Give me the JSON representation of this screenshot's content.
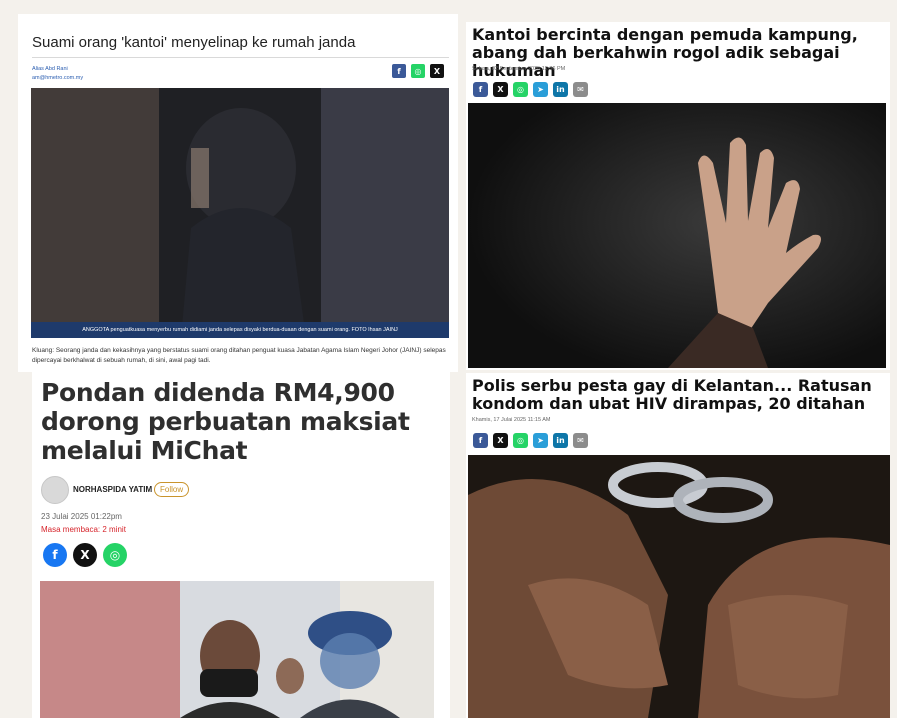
{
  "article1": {
    "title": "Suami orang 'kantoi' menyelinap ke rumah janda",
    "author": "Alias Abd Rani",
    "email": "am@hmetro.com.my",
    "share": [
      "f",
      "◎",
      "X"
    ],
    "photo_caption": "ANGGOTA penguatkuasa menyerbu rumah didiami janda selepas disyaki berdua-duaan dengan suami orang. FOTO Ihsan JAINJ",
    "lede": "Kluang: Seorang janda dan kekasihnya yang berstatus suami orang ditahan penguat kuasa Jabatan Agama Islam Negeri Johor (JAINJ) selepas dipercayai berkhalwat di sebuah rumah, di sini, awal pagi tadi."
  },
  "article2": {
    "title": "Kantoi bercinta dengan pemuda kampung, abang dah berkahwin rogol adik sebagai hukuman",
    "date": "Selasa, 02 September 2025 12:36 PM",
    "share": [
      "f",
      "X",
      "◎",
      "➤",
      "in",
      "✉"
    ]
  },
  "article3": {
    "title": "Pondan didenda RM4,900 dorong perbuatan maksiat melalui MiChat",
    "author": "NORHASPIDA YATIM",
    "follow": "Follow",
    "date": "23 Julai 2025 01:22pm",
    "reading_time": "Masa membaca: 2 minit",
    "share": [
      "f",
      "X",
      "◎"
    ]
  },
  "article4": {
    "title": "Polis serbu pesta gay di Kelantan... Ratusan kondom dan ubat HIV dirampas, 20 ditahan",
    "date": "Khamis, 17 Julai 2025 11:15 AM",
    "share": [
      "f",
      "X",
      "◎",
      "➤",
      "in",
      "✉"
    ]
  },
  "colors": {
    "facebook": "#3b5998",
    "whatsapp": "#25d366",
    "x": "#111111",
    "telegram": "#2a9ed8",
    "linkedin": "#0e76a8",
    "email": "#8c8c8c",
    "caption_bar": "#1e3a6b",
    "follow": "#c9942c",
    "reading_time": "#d6232a"
  }
}
